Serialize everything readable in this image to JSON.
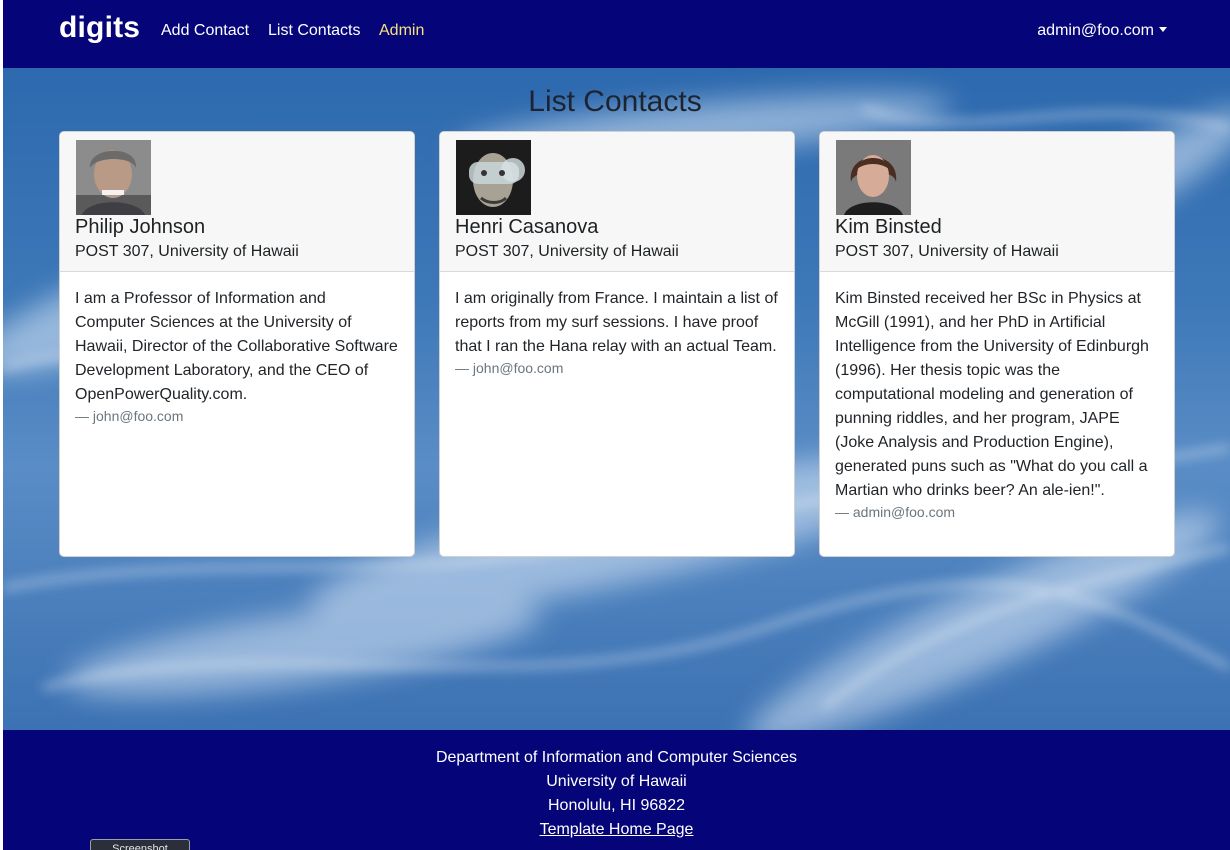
{
  "navbar": {
    "brand": "digits",
    "links": [
      "Add Contact",
      "List Contacts",
      "Admin"
    ],
    "user": "admin@foo.com"
  },
  "page": {
    "title": "List Contacts"
  },
  "contacts": [
    {
      "name": "Philip Johnson",
      "address": "POST 307, University of Hawaii",
      "description": "I am a Professor of Information and Computer Sciences at the University of Hawaii, Director of the Collaborative Software Development Laboratory, and the CEO of OpenPowerQuality.com.",
      "owner": "— john@foo.com"
    },
    {
      "name": "Henri Casanova",
      "address": "POST 307, University of Hawaii",
      "description": "I am originally from France. I maintain a list of reports from my surf sessions. I have proof that I ran the Hana relay with an actual Team.",
      "owner": "— john@foo.com"
    },
    {
      "name": "Kim Binsted",
      "address": "POST 307, University of Hawaii",
      "description": "Kim Binsted received her BSc in Physics at McGill (1991), and her PhD in Artificial Intelligence from the University of Edinburgh (1996). Her thesis topic was the computational modeling and generation of punning riddles, and her program, JAPE (Joke Analysis and Production Engine), generated puns such as \"What do you call a Martian who drinks beer? An ale-ien!\".",
      "owner": "— admin@foo.com"
    }
  ],
  "footer": {
    "line1": "Department of Information and Computer Sciences",
    "line2": "University of Hawaii",
    "line3": "Honolulu, HI 96822",
    "link": "Template Home Page"
  },
  "overlay": {
    "screenshot_label": "Screenshot"
  },
  "colors": {
    "navbar": "#050579",
    "admin_link": "#f5e27a",
    "sky": "#3d78b8"
  }
}
